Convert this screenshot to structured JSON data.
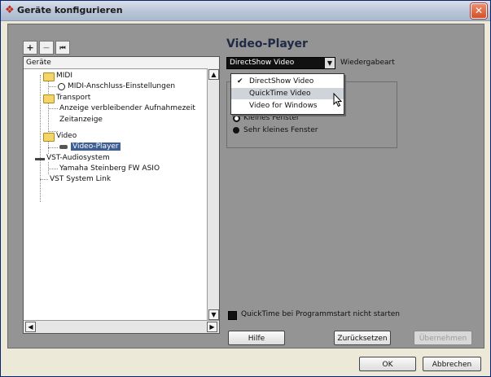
{
  "window": {
    "title": "Geräte konfigurieren",
    "close_label": "✕",
    "app_icon": "cubase-icon"
  },
  "toolbar": {
    "add_label": "+",
    "remove_label": "−",
    "reset_label": "⏮"
  },
  "tree": {
    "header": "Geräte",
    "items": [
      {
        "label": "MIDI",
        "type": "folder"
      },
      {
        "label": "MIDI-Anschluss-Einstellungen",
        "type": "midi"
      },
      {
        "label": "Transport",
        "type": "folder"
      },
      {
        "label": "Anzeige verbleibender Aufnahmezeit",
        "type": "leaf"
      },
      {
        "label": "Zeitanzeige",
        "type": "leaf"
      },
      {
        "label": "Video",
        "type": "folder"
      },
      {
        "label": "Video-Player",
        "type": "video",
        "selected": true
      },
      {
        "label": "VST-Audiosystem",
        "type": "audio"
      },
      {
        "label": "Yamaha Steinberg FW ASIO",
        "type": "leaf"
      },
      {
        "label": "VST System Link",
        "type": "leaf"
      }
    ]
  },
  "panel": {
    "title": "Video-Player",
    "combo_value": "DirectShow Video",
    "combo_label": "Wiedergabeart",
    "dropdown_options": [
      "DirectShow Video",
      "QuickTime Video",
      "Video for Windows"
    ],
    "dropdown_checked": "DirectShow Video",
    "dropdown_highlighted": "QuickTime Video",
    "radio_options": [
      "Kleines Fenster",
      "Sehr kleines Fenster"
    ],
    "checkbox_label": "QuickTime bei Programmstart nicht starten"
  },
  "buttons": {
    "help": "Hilfe",
    "reset": "Zurücksetzen",
    "apply": "Übernehmen",
    "ok": "OK",
    "cancel": "Abbrechen"
  },
  "colors": {
    "selection": "#3d5f96",
    "panel_bg": "#949494",
    "title_accent": "#c0281e"
  }
}
